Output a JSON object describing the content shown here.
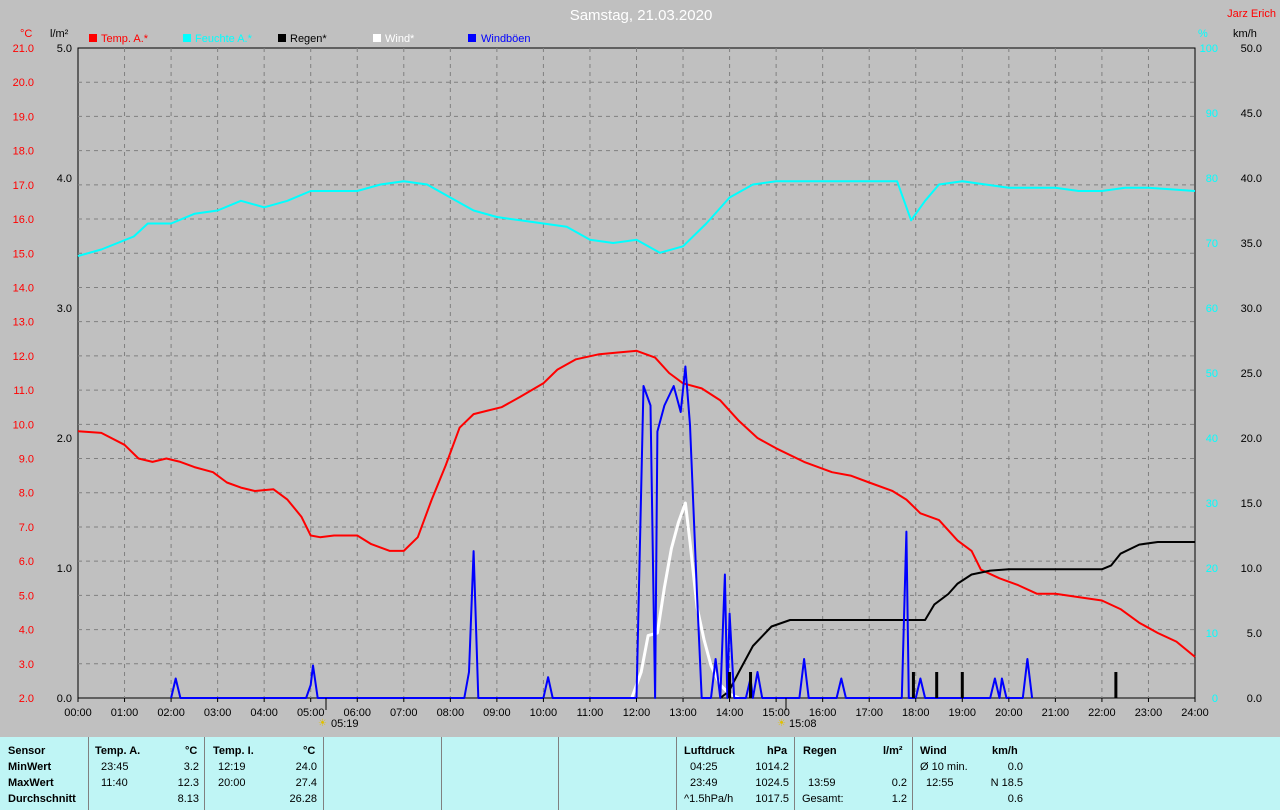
{
  "title": "Samstag, 21.03.2020",
  "author": "Jarz Erich",
  "legend": [
    {
      "label": "Temp. A.*",
      "color": "#ff0000"
    },
    {
      "label": "Feuchte A.*",
      "color": "#00ffff"
    },
    {
      "label": "Regen*",
      "color": "#000000"
    },
    {
      "label": "Wind*",
      "color": "#ffffff"
    },
    {
      "label": "Windböen",
      "color": "#0000ff"
    }
  ],
  "units": {
    "temp": "°C",
    "rain": "l/m²",
    "humidity": "%",
    "wind": "km/h"
  },
  "axes": {
    "temp_ticks": [
      "2.0",
      "3.0",
      "4.0",
      "5.0",
      "6.0",
      "7.0",
      "8.0",
      "9.0",
      "10.0",
      "11.0",
      "12.0",
      "13.0",
      "14.0",
      "15.0",
      "16.0",
      "17.0",
      "18.0",
      "19.0",
      "20.0",
      "21.0"
    ],
    "rain_ticks": [
      "0.0",
      "1.0",
      "2.0",
      "3.0",
      "4.0",
      "5.0"
    ],
    "humidity_ticks": [
      "0",
      "10",
      "20",
      "30",
      "40",
      "50",
      "60",
      "70",
      "80",
      "90",
      "100"
    ],
    "wind_ticks": [
      "0.0",
      "5.0",
      "10.0",
      "15.0",
      "20.0",
      "25.0",
      "30.0",
      "35.0",
      "40.0",
      "45.0",
      "50.0"
    ],
    "time_ticks": [
      "00:00",
      "01:00",
      "02:00",
      "03:00",
      "04:00",
      "05:00",
      "06:00",
      "07:00",
      "08:00",
      "09:00",
      "10:00",
      "11:00",
      "12:00",
      "13:00",
      "14:00",
      "15:00",
      "16:00",
      "17:00",
      "18:00",
      "19:00",
      "20:00",
      "21:00",
      "22:00",
      "23:00",
      "24:00"
    ]
  },
  "sunrise": "05:19",
  "sunset": "15:08",
  "chart_data": {
    "type": "line",
    "x_unit": "hours",
    "ylim_temp": [
      2,
      21
    ],
    "ylim_rain": [
      0,
      5
    ],
    "ylim_humidity": [
      0,
      100
    ],
    "ylim_wind": [
      0,
      50
    ],
    "grid": true,
    "series": [
      {
        "name": "Temp. A.*",
        "axis": "temp",
        "color": "#ff0000",
        "points": [
          [
            0,
            9.8
          ],
          [
            0.5,
            9.75
          ],
          [
            1,
            9.4
          ],
          [
            1.3,
            9.0
          ],
          [
            1.6,
            8.9
          ],
          [
            1.9,
            9.0
          ],
          [
            2.2,
            8.9
          ],
          [
            2.5,
            8.75
          ],
          [
            2.9,
            8.6
          ],
          [
            3.2,
            8.3
          ],
          [
            3.5,
            8.15
          ],
          [
            3.8,
            8.05
          ],
          [
            4.2,
            8.1
          ],
          [
            4.5,
            7.8
          ],
          [
            4.8,
            7.3
          ],
          [
            5.0,
            6.75
          ],
          [
            5.2,
            6.7
          ],
          [
            5.5,
            6.75
          ],
          [
            6.0,
            6.75
          ],
          [
            6.3,
            6.5
          ],
          [
            6.7,
            6.3
          ],
          [
            7.0,
            6.3
          ],
          [
            7.3,
            6.7
          ],
          [
            7.6,
            7.8
          ],
          [
            7.9,
            8.8
          ],
          [
            8.2,
            9.9
          ],
          [
            8.5,
            10.3
          ],
          [
            8.8,
            10.4
          ],
          [
            9.1,
            10.5
          ],
          [
            9.5,
            10.8
          ],
          [
            10.0,
            11.2
          ],
          [
            10.3,
            11.6
          ],
          [
            10.7,
            11.9
          ],
          [
            11.2,
            12.05
          ],
          [
            11.6,
            12.1
          ],
          [
            12.0,
            12.15
          ],
          [
            12.4,
            11.95
          ],
          [
            12.7,
            11.5
          ],
          [
            13.0,
            11.2
          ],
          [
            13.4,
            11.05
          ],
          [
            13.8,
            10.7
          ],
          [
            14.2,
            10.1
          ],
          [
            14.6,
            9.6
          ],
          [
            15.0,
            9.3
          ],
          [
            15.6,
            8.9
          ],
          [
            16.2,
            8.6
          ],
          [
            16.6,
            8.5
          ],
          [
            17.0,
            8.3
          ],
          [
            17.5,
            8.05
          ],
          [
            17.8,
            7.8
          ],
          [
            18.1,
            7.4
          ],
          [
            18.5,
            7.2
          ],
          [
            18.9,
            6.6
          ],
          [
            19.2,
            6.3
          ],
          [
            19.4,
            5.75
          ],
          [
            19.8,
            5.5
          ],
          [
            20.2,
            5.3
          ],
          [
            20.6,
            5.05
          ],
          [
            21.0,
            5.05
          ],
          [
            21.5,
            4.95
          ],
          [
            22.0,
            4.85
          ],
          [
            22.4,
            4.6
          ],
          [
            22.8,
            4.2
          ],
          [
            23.2,
            3.9
          ],
          [
            23.6,
            3.65
          ],
          [
            24.0,
            3.2
          ]
        ]
      },
      {
        "name": "Feuchte A.*",
        "axis": "humidity",
        "color": "#00ffff",
        "points": [
          [
            0,
            68
          ],
          [
            0.5,
            69
          ],
          [
            1.2,
            71
          ],
          [
            1.5,
            73
          ],
          [
            2.0,
            73
          ],
          [
            2.5,
            74.5
          ],
          [
            3.0,
            75
          ],
          [
            3.5,
            76.5
          ],
          [
            4.0,
            75.5
          ],
          [
            4.5,
            76.5
          ],
          [
            5.0,
            78
          ],
          [
            5.5,
            78
          ],
          [
            6.0,
            78
          ],
          [
            6.5,
            79
          ],
          [
            7.0,
            79.5
          ],
          [
            7.5,
            79
          ],
          [
            8.0,
            77
          ],
          [
            8.5,
            75
          ],
          [
            9.0,
            74
          ],
          [
            9.5,
            73.5
          ],
          [
            10.0,
            73
          ],
          [
            10.5,
            72.5
          ],
          [
            11.0,
            70.5
          ],
          [
            11.5,
            70
          ],
          [
            12.0,
            70.5
          ],
          [
            12.5,
            68.5
          ],
          [
            13.0,
            69.5
          ],
          [
            13.5,
            73
          ],
          [
            14.0,
            77
          ],
          [
            14.5,
            79
          ],
          [
            15.0,
            79.5
          ],
          [
            16.0,
            79.5
          ],
          [
            17.0,
            79.5
          ],
          [
            17.6,
            79.5
          ],
          [
            17.9,
            73.5
          ],
          [
            18.2,
            76.5
          ],
          [
            18.5,
            79
          ],
          [
            19.0,
            79.5
          ],
          [
            20.0,
            78.5
          ],
          [
            21.0,
            78.5
          ],
          [
            21.5,
            78
          ],
          [
            22.0,
            78
          ],
          [
            22.5,
            78.5
          ],
          [
            23.0,
            78.5
          ],
          [
            24.0,
            78
          ]
        ]
      },
      {
        "name": "Regen*",
        "axis": "rain",
        "color": "#000000",
        "points": [
          [
            13.8,
            0
          ],
          [
            13.98,
            0.05
          ],
          [
            14.2,
            0.2
          ],
          [
            14.5,
            0.4
          ],
          [
            14.9,
            0.55
          ],
          [
            15.3,
            0.6
          ],
          [
            16.0,
            0.6
          ],
          [
            17.0,
            0.6
          ],
          [
            18.0,
            0.6
          ],
          [
            18.2,
            0.6
          ],
          [
            18.4,
            0.72
          ],
          [
            18.7,
            0.8
          ],
          [
            18.9,
            0.88
          ],
          [
            19.2,
            0.95
          ],
          [
            19.6,
            0.98
          ],
          [
            20.0,
            0.99
          ],
          [
            21.0,
            0.99
          ],
          [
            22.0,
            0.99
          ],
          [
            22.2,
            1.02
          ],
          [
            22.4,
            1.11
          ],
          [
            22.8,
            1.18
          ],
          [
            23.2,
            1.2
          ],
          [
            24.0,
            1.2
          ]
        ]
      },
      {
        "name": "Wind*",
        "axis": "wind",
        "color": "#ffffff",
        "points": [
          [
            11.9,
            0
          ],
          [
            12.1,
            2.0
          ],
          [
            12.25,
            4.8
          ],
          [
            12.45,
            5.0
          ],
          [
            12.6,
            8.5
          ],
          [
            12.75,
            11.5
          ],
          [
            12.9,
            13.5
          ],
          [
            13.05,
            15.0
          ],
          [
            13.15,
            12.0
          ],
          [
            13.3,
            7.0
          ],
          [
            13.45,
            4.5
          ],
          [
            13.6,
            2.5
          ],
          [
            13.8,
            1.0
          ],
          [
            14.0,
            0.3
          ],
          [
            14.2,
            0
          ]
        ]
      },
      {
        "name": "Windböen",
        "axis": "wind",
        "color": "#0000ff",
        "points": [
          [
            2.0,
            0
          ],
          [
            2.1,
            1.5
          ],
          [
            2.2,
            0
          ],
          [
            4.9,
            0
          ],
          [
            5.0,
            1.0
          ],
          [
            5.05,
            2.5
          ],
          [
            5.15,
            0
          ],
          [
            8.3,
            0
          ],
          [
            8.4,
            2.0
          ],
          [
            8.5,
            11.3
          ],
          [
            8.6,
            0
          ],
          [
            10.0,
            0
          ],
          [
            10.1,
            1.6
          ],
          [
            10.2,
            0
          ],
          [
            12.0,
            0
          ],
          [
            12.15,
            24.0
          ],
          [
            12.3,
            22.5
          ],
          [
            12.4,
            0
          ],
          [
            12.45,
            20.5
          ],
          [
            12.6,
            22.5
          ],
          [
            12.8,
            24.0
          ],
          [
            12.95,
            22.0
          ],
          [
            13.05,
            25.5
          ],
          [
            13.15,
            21.0
          ],
          [
            13.3,
            8.0
          ],
          [
            13.4,
            0
          ],
          [
            13.6,
            0
          ],
          [
            13.7,
            3.0
          ],
          [
            13.8,
            0
          ],
          [
            13.9,
            9.5
          ],
          [
            13.95,
            0
          ],
          [
            14.0,
            6.5
          ],
          [
            14.1,
            0
          ],
          [
            14.35,
            0
          ],
          [
            14.45,
            1.5
          ],
          [
            14.5,
            0
          ],
          [
            14.6,
            2.0
          ],
          [
            14.7,
            0
          ],
          [
            15.5,
            0
          ],
          [
            15.6,
            3.0
          ],
          [
            15.7,
            0
          ],
          [
            16.3,
            0
          ],
          [
            16.4,
            1.5
          ],
          [
            16.5,
            0
          ],
          [
            17.7,
            0
          ],
          [
            17.8,
            12.8
          ],
          [
            17.85,
            0
          ],
          [
            18.0,
            0
          ],
          [
            18.1,
            1.5
          ],
          [
            18.2,
            0
          ],
          [
            19.6,
            0
          ],
          [
            19.7,
            1.5
          ],
          [
            19.8,
            0
          ],
          [
            19.85,
            1.5
          ],
          [
            19.95,
            0
          ],
          [
            20.3,
            0
          ],
          [
            20.4,
            3.0
          ],
          [
            20.5,
            0
          ]
        ]
      },
      {
        "name": "Regen (Intervall)",
        "axis": "rain",
        "color": "#000000",
        "bars": [
          [
            14.0,
            0.2
          ],
          [
            14.45,
            0.2
          ],
          [
            17.95,
            0.2
          ],
          [
            18.45,
            0.2
          ],
          [
            19.0,
            0.2
          ],
          [
            22.3,
            0.2
          ]
        ]
      }
    ]
  },
  "stats": {
    "sensor_header": "Sensor",
    "row_labels": [
      "MinWert",
      "MaxWert",
      "Durchschnitt"
    ],
    "temp_a": {
      "header": "Temp. A.",
      "unit": "°C",
      "min_time": "23:45",
      "min": "3.2",
      "max_time": "11:40",
      "max": "12.3",
      "avg": "8.13"
    },
    "temp_i": {
      "header": "Temp. I.",
      "unit": "°C",
      "min_time": "12:19",
      "min": "24.0",
      "max_time": "20:00",
      "max": "27.4",
      "avg": "26.28"
    },
    "pressure": {
      "header": "Luftdruck",
      "unit": "hPa",
      "min_time": "04:25",
      "min": "1014.2",
      "max_time": "23:49",
      "max": "1024.5",
      "trend_label": "^1.5hPa/h",
      "trend": "1017.5"
    },
    "rain": {
      "header": "Regen",
      "unit": "l/m²",
      "max_time": "13:59",
      "max": "0.2",
      "total_label": "Gesamt:",
      "total": "1.2"
    },
    "wind": {
      "header": "Wind",
      "unit": "km/h",
      "avg_label": "Ø 10 min.",
      "avg": "0.0",
      "max_time": "12:55",
      "max": "N 18.5",
      "mean": "0.6"
    }
  }
}
